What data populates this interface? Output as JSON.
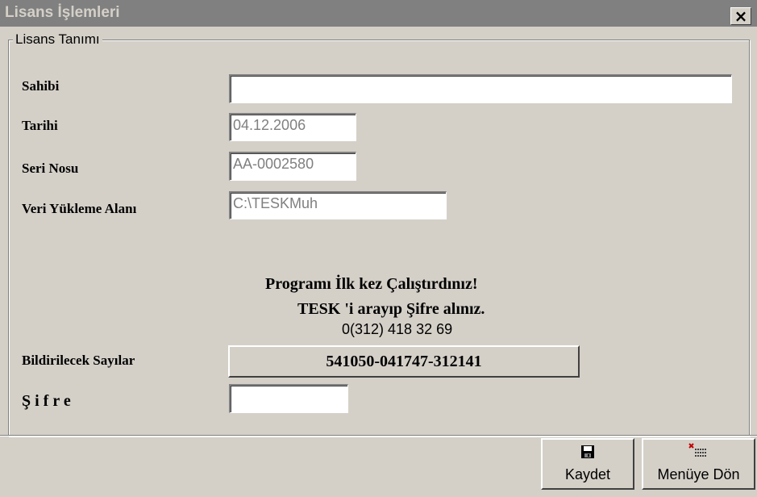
{
  "window": {
    "title": "Lisans İşlemleri",
    "close_glyph": "×"
  },
  "group": {
    "legend": "Lisans Tanımı"
  },
  "fields": {
    "sahibi": {
      "label": "Sahibi",
      "value": ""
    },
    "tarihi": {
      "label": "Tarihi",
      "value": "04.12.2006"
    },
    "seri_nosu": {
      "label": "Seri Nosu",
      "value": "AA-0002580"
    },
    "veri_yukleme": {
      "label": "Veri Yükleme Alanı",
      "value": "C:\\TESKMuh"
    }
  },
  "message": {
    "line1": "Programı İlk kez Çalıştırdınız!",
    "line2": "TESK 'i arayıp Şifre alınız.",
    "phone": "0(312) 418 32 69"
  },
  "numbers": {
    "label": "Bildirilecek Sayılar",
    "code": "541050-041747-312141"
  },
  "password": {
    "label": "Ş i f r e",
    "value": ""
  },
  "toolbar": {
    "save_label": "Kaydet",
    "back_label": "Menüye Dön"
  },
  "icons": {
    "save": "floppy-disk-icon",
    "back": "menu-return-icon"
  },
  "colors": {
    "face": "#d4d0c8",
    "titlebar": "#808080",
    "shadow": "#404040",
    "disabled_text": "#808080"
  }
}
